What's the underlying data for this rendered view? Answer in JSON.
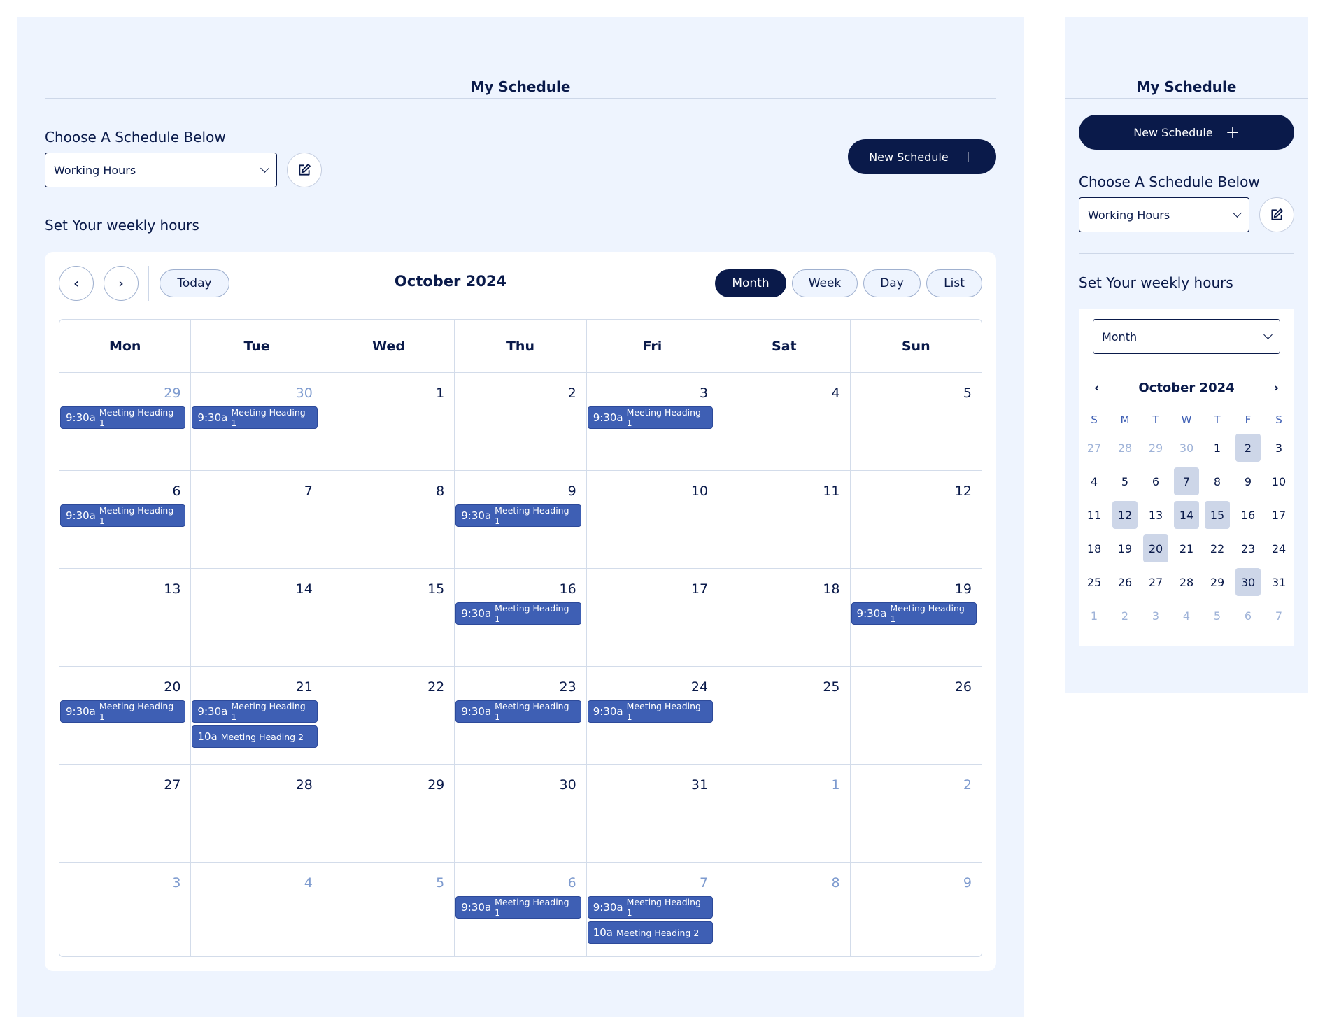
{
  "main": {
    "title": "My Schedule",
    "choose_label": "Choose A Schedule Below",
    "schedule_value": "Working Hours",
    "new_schedule_label": "New Schedule",
    "weekly_label": "Set Your weekly hours"
  },
  "calendar": {
    "title": "October 2024",
    "today_label": "Today",
    "views": [
      "Month",
      "Week",
      "Day",
      "List"
    ],
    "active_view": "Month",
    "weekdays": [
      "Mon",
      "Tue",
      "Wed",
      "Thu",
      "Fri",
      "Sat",
      "Sun"
    ],
    "weeks": [
      [
        {
          "day": "29",
          "other": true,
          "events": [
            {
              "time": "9:30a",
              "title": "Meeting Heading 1"
            }
          ]
        },
        {
          "day": "30",
          "other": true,
          "events": [
            {
              "time": "9:30a",
              "title": "Meeting Heading 1"
            }
          ]
        },
        {
          "day": "1",
          "other": false,
          "events": []
        },
        {
          "day": "2",
          "other": false,
          "events": []
        },
        {
          "day": "3",
          "other": false,
          "events": [
            {
              "time": "9:30a",
              "title": "Meeting Heading 1"
            }
          ]
        },
        {
          "day": "4",
          "other": false,
          "events": []
        },
        {
          "day": "5",
          "other": false,
          "events": []
        }
      ],
      [
        {
          "day": "6",
          "other": false,
          "events": [
            {
              "time": "9:30a",
              "title": "Meeting Heading 1"
            }
          ]
        },
        {
          "day": "7",
          "other": false,
          "events": []
        },
        {
          "day": "8",
          "other": false,
          "events": []
        },
        {
          "day": "9",
          "other": false,
          "events": [
            {
              "time": "9:30a",
              "title": "Meeting Heading 1"
            }
          ]
        },
        {
          "day": "10",
          "other": false,
          "events": []
        },
        {
          "day": "11",
          "other": false,
          "events": []
        },
        {
          "day": "12",
          "other": false,
          "events": []
        }
      ],
      [
        {
          "day": "13",
          "other": false,
          "events": []
        },
        {
          "day": "14",
          "other": false,
          "events": []
        },
        {
          "day": "15",
          "other": false,
          "events": []
        },
        {
          "day": "16",
          "other": false,
          "events": [
            {
              "time": "9:30a",
              "title": "Meeting Heading 1"
            }
          ]
        },
        {
          "day": "17",
          "other": false,
          "events": []
        },
        {
          "day": "18",
          "other": false,
          "events": []
        },
        {
          "day": "19",
          "other": false,
          "events": [
            {
              "time": "9:30a",
              "title": "Meeting Heading 1"
            }
          ]
        }
      ],
      [
        {
          "day": "20",
          "other": false,
          "events": [
            {
              "time": "9:30a",
              "title": "Meeting Heading 1"
            }
          ]
        },
        {
          "day": "21",
          "other": false,
          "events": [
            {
              "time": "9:30a",
              "title": "Meeting Heading 1"
            },
            {
              "time": "10a",
              "title": "Meeting Heading 2"
            }
          ]
        },
        {
          "day": "22",
          "other": false,
          "events": []
        },
        {
          "day": "23",
          "other": false,
          "events": [
            {
              "time": "9:30a",
              "title": "Meeting Heading 1"
            }
          ]
        },
        {
          "day": "24",
          "other": false,
          "events": [
            {
              "time": "9:30a",
              "title": "Meeting Heading 1"
            }
          ]
        },
        {
          "day": "25",
          "other": false,
          "events": []
        },
        {
          "day": "26",
          "other": false,
          "events": []
        }
      ],
      [
        {
          "day": "27",
          "other": false,
          "events": []
        },
        {
          "day": "28",
          "other": false,
          "events": []
        },
        {
          "day": "29",
          "other": false,
          "events": []
        },
        {
          "day": "30",
          "other": false,
          "events": []
        },
        {
          "day": "31",
          "other": false,
          "events": []
        },
        {
          "day": "1",
          "other": true,
          "events": []
        },
        {
          "day": "2",
          "other": true,
          "events": []
        }
      ],
      [
        {
          "day": "3",
          "other": true,
          "events": []
        },
        {
          "day": "4",
          "other": true,
          "events": []
        },
        {
          "day": "5",
          "other": true,
          "events": []
        },
        {
          "day": "6",
          "other": true,
          "events": [
            {
              "time": "9:30a",
              "title": "Meeting Heading 1"
            }
          ]
        },
        {
          "day": "7",
          "other": true,
          "events": [
            {
              "time": "9:30a",
              "title": "Meeting Heading 1"
            },
            {
              "time": "10a",
              "title": "Meeting Heading 2"
            }
          ]
        },
        {
          "day": "8",
          "other": true,
          "events": []
        },
        {
          "day": "9",
          "other": true,
          "events": []
        }
      ]
    ]
  },
  "side": {
    "title": "My Schedule",
    "new_schedule_label": "New Schedule",
    "choose_label": "Choose A Schedule Below",
    "schedule_value": "Working Hours",
    "weekly_label": "Set Your weekly hours",
    "view_value": "Month",
    "mini_title": "October 2024",
    "mini_weekdays": [
      "S",
      "M",
      "T",
      "W",
      "T",
      "F",
      "S"
    ],
    "mini_days": [
      {
        "d": "27",
        "other": true,
        "hl": false
      },
      {
        "d": "28",
        "other": true,
        "hl": false
      },
      {
        "d": "29",
        "other": true,
        "hl": false
      },
      {
        "d": "30",
        "other": true,
        "hl": false
      },
      {
        "d": "1",
        "other": false,
        "hl": false
      },
      {
        "d": "2",
        "other": false,
        "hl": true
      },
      {
        "d": "3",
        "other": false,
        "hl": false
      },
      {
        "d": "4",
        "other": false,
        "hl": false
      },
      {
        "d": "5",
        "other": false,
        "hl": false
      },
      {
        "d": "6",
        "other": false,
        "hl": false
      },
      {
        "d": "7",
        "other": false,
        "hl": true
      },
      {
        "d": "8",
        "other": false,
        "hl": false
      },
      {
        "d": "9",
        "other": false,
        "hl": false
      },
      {
        "d": "10",
        "other": false,
        "hl": false
      },
      {
        "d": "11",
        "other": false,
        "hl": false
      },
      {
        "d": "12",
        "other": false,
        "hl": true
      },
      {
        "d": "13",
        "other": false,
        "hl": false
      },
      {
        "d": "14",
        "other": false,
        "hl": true
      },
      {
        "d": "15",
        "other": false,
        "hl": true
      },
      {
        "d": "16",
        "other": false,
        "hl": false
      },
      {
        "d": "17",
        "other": false,
        "hl": false
      },
      {
        "d": "18",
        "other": false,
        "hl": false
      },
      {
        "d": "19",
        "other": false,
        "hl": false
      },
      {
        "d": "20",
        "other": false,
        "hl": true
      },
      {
        "d": "21",
        "other": false,
        "hl": false
      },
      {
        "d": "22",
        "other": false,
        "hl": false
      },
      {
        "d": "23",
        "other": false,
        "hl": false
      },
      {
        "d": "24",
        "other": false,
        "hl": false
      },
      {
        "d": "25",
        "other": false,
        "hl": false
      },
      {
        "d": "26",
        "other": false,
        "hl": false
      },
      {
        "d": "27",
        "other": false,
        "hl": false
      },
      {
        "d": "28",
        "other": false,
        "hl": false
      },
      {
        "d": "29",
        "other": false,
        "hl": false
      },
      {
        "d": "30",
        "other": false,
        "hl": true
      },
      {
        "d": "31",
        "other": false,
        "hl": false
      },
      {
        "d": "1",
        "other": true,
        "hl": false
      },
      {
        "d": "2",
        "other": true,
        "hl": false
      },
      {
        "d": "3",
        "other": true,
        "hl": false
      },
      {
        "d": "4",
        "other": true,
        "hl": false
      },
      {
        "d": "5",
        "other": true,
        "hl": false
      },
      {
        "d": "6",
        "other": true,
        "hl": false
      },
      {
        "d": "7",
        "other": true,
        "hl": false
      }
    ]
  },
  "colors": {
    "navy": "#0a1a4a",
    "panel_bg": "#eef4fe",
    "event_bg": "#3e5fb4",
    "muted_day": "#7e9bcf",
    "highlight": "#cdd6e8"
  },
  "icons": {
    "edit": "edit-icon",
    "plus": "plus-icon",
    "prev": "chevron-left-icon",
    "next": "chevron-right-icon",
    "dropdown": "chevron-down-icon"
  }
}
